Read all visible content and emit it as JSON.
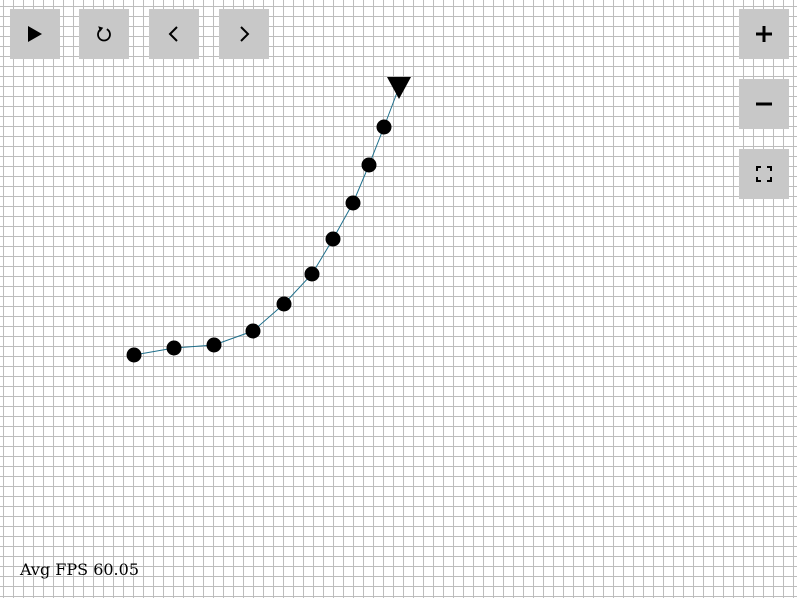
{
  "toolbar": {
    "play": {
      "icon": "play-icon"
    },
    "reset": {
      "icon": "reset-icon"
    },
    "prev": {
      "icon": "chevron-left-icon"
    },
    "next": {
      "icon": "chevron-right-icon"
    }
  },
  "zoom_controls": {
    "zoom_in": {
      "icon": "plus-icon"
    },
    "zoom_out": {
      "icon": "minus-icon"
    },
    "fullscreen": {
      "icon": "fullscreen-icon"
    }
  },
  "status": {
    "fps_text": "Avg FPS 60.05"
  },
  "colors": {
    "grid": "#bdbdbd",
    "button_bg": "#c8c8c8",
    "trace": "#1f6f8b",
    "node": "#000000"
  }
}
